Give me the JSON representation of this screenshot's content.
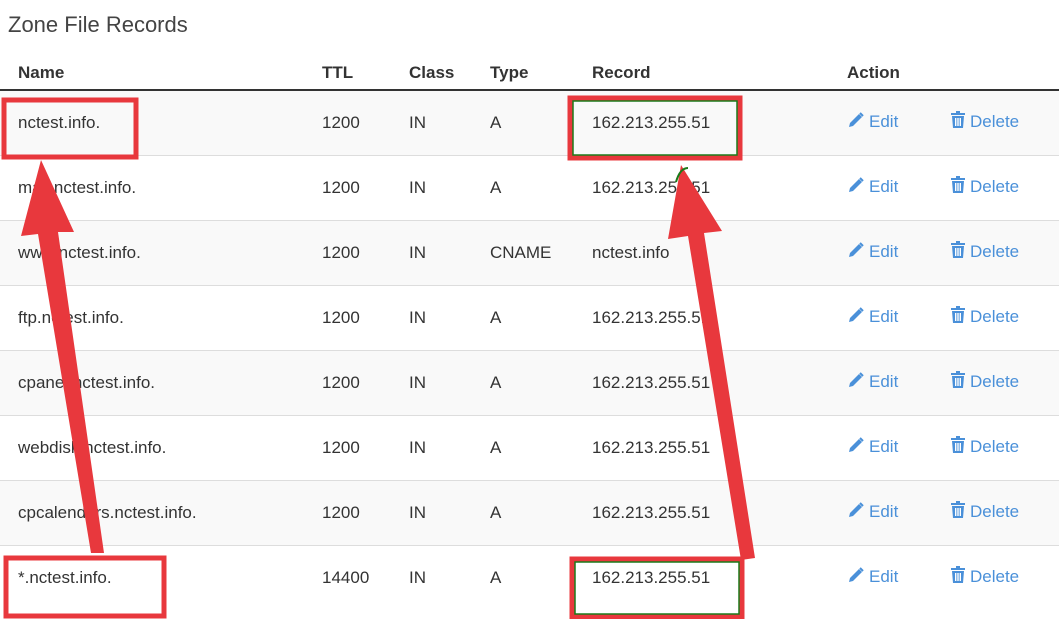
{
  "title": "Zone File Records",
  "columns": {
    "name": "Name",
    "ttl": "TTL",
    "class": "Class",
    "type": "Type",
    "record": "Record",
    "action": "Action"
  },
  "actions": {
    "edit": "Edit",
    "delete": "Delete"
  },
  "rows": [
    {
      "name": "nctest.info.",
      "ttl": "1200",
      "class": "IN",
      "type": "A",
      "record": "162.213.255.51"
    },
    {
      "name": "mail.nctest.info.",
      "ttl": "1200",
      "class": "IN",
      "type": "A",
      "record": "162.213.255.51"
    },
    {
      "name": "www.nctest.info.",
      "ttl": "1200",
      "class": "IN",
      "type": "CNAME",
      "record": "nctest.info"
    },
    {
      "name": "ftp.nctest.info.",
      "ttl": "1200",
      "class": "IN",
      "type": "A",
      "record": "162.213.255.51"
    },
    {
      "name": "cpanel.nctest.info.",
      "ttl": "1200",
      "class": "IN",
      "type": "A",
      "record": "162.213.255.51"
    },
    {
      "name": "webdisk.nctest.info.",
      "ttl": "1200",
      "class": "IN",
      "type": "A",
      "record": "162.213.255.51"
    },
    {
      "name": "cpcalendars.nctest.info.",
      "ttl": "1200",
      "class": "IN",
      "type": "A",
      "record": "162.213.255.51"
    },
    {
      "name": "*.nctest.info.",
      "ttl": "14400",
      "class": "IN",
      "type": "A",
      "record": "162.213.255.51"
    }
  ],
  "colors": {
    "link": "#4a90d9",
    "annotation_red": "#e8383d",
    "annotation_green": "#1a7a1a"
  }
}
